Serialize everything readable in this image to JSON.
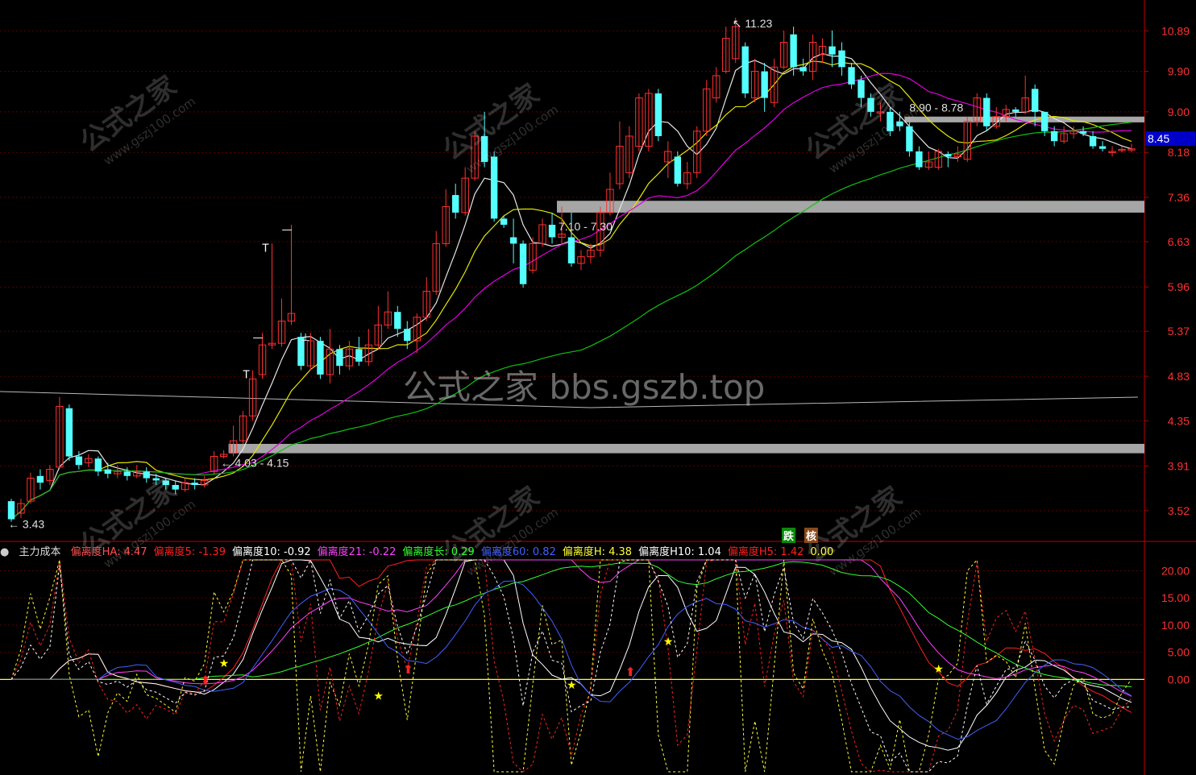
{
  "colors": {
    "background": "#000000",
    "bull": "#ff3030",
    "bear": "#54ffff",
    "axis": "#c00000",
    "ma_white": "#e6e6e6",
    "ma_yellow": "#e6e600",
    "ma_magenta": "#e000e0",
    "ma_green": "#10c010",
    "zone": "#a6a6a6",
    "price_tag_bg": "#0000c8"
  },
  "price_axis": {
    "labels": [
      "10.89",
      "9.90",
      "9.00",
      "8.18",
      "7.36",
      "6.63",
      "5.96",
      "5.37",
      "4.83",
      "4.35",
      "3.91",
      "3.52"
    ],
    "current_price": "8.45"
  },
  "annotations": {
    "high": "11.23",
    "low": "3.43",
    "zone_low": "4.03 - 4.15",
    "zone_mid": "7.10 - 7.30",
    "zone_high": "8.90 - 8.78"
  },
  "watermark": {
    "main": "公式之家 bbs.gszb.top",
    "stamp_cn": "公式之家",
    "stamp_url": "www.gszj100.com"
  },
  "signals": {
    "fall": "跌",
    "check": "核"
  },
  "indicator": {
    "name": "主力成本",
    "toggle_icon": "circle-toggle-icon",
    "items": [
      {
        "label": "偏离度HA: 4.47",
        "color": "#ff5050"
      },
      {
        "label": "偏离度5: -1.39",
        "color": "#ff2020"
      },
      {
        "label": "偏离度10: -0.92",
        "color": "#ffffff"
      },
      {
        "label": "偏离度21: -0.22",
        "color": "#ff40ff"
      },
      {
        "label": "偏离度长: 0.29",
        "color": "#30ff30"
      },
      {
        "label": "偏离度60: 0.82",
        "color": "#4060ff"
      },
      {
        "label": "偏离度H: 4.38",
        "color": "#ffff30"
      },
      {
        "label": "偏离度H10: 1.04",
        "color": "#ffffff"
      },
      {
        "label": "偏离度H5: 1.42",
        "color": "#ff2020"
      },
      {
        "label": "0.00",
        "color": "#ffff30"
      }
    ],
    "axis_labels": [
      "20.00",
      "15.00",
      "10.00",
      "5.00",
      "0.00"
    ]
  },
  "chart_data": {
    "type": "candlestick",
    "ylim": [
      3.3,
      11.6
    ],
    "candles": [
      [
        3.6,
        3.45,
        3.62,
        3.43
      ],
      [
        3.5,
        3.58,
        3.62,
        3.46
      ],
      [
        3.6,
        3.8,
        3.85,
        3.58
      ],
      [
        3.82,
        3.76,
        3.88,
        3.7
      ],
      [
        3.78,
        3.88,
        3.92,
        3.74
      ],
      [
        3.9,
        4.5,
        4.6,
        3.88
      ],
      [
        4.48,
        4.0,
        4.52,
        3.96
      ],
      [
        4.0,
        3.92,
        4.05,
        3.88
      ],
      [
        3.94,
        3.98,
        4.02,
        3.9
      ],
      [
        3.98,
        3.86,
        4.0,
        3.82
      ],
      [
        3.88,
        3.84,
        3.94,
        3.8
      ],
      [
        3.84,
        3.86,
        3.92,
        3.8
      ],
      [
        3.86,
        3.82,
        3.9,
        3.78
      ],
      [
        3.82,
        3.86,
        3.92,
        3.8
      ],
      [
        3.86,
        3.8,
        3.9,
        3.76
      ],
      [
        3.8,
        3.78,
        3.84,
        3.74
      ],
      [
        3.78,
        3.74,
        3.8,
        3.7
      ],
      [
        3.74,
        3.7,
        3.78,
        3.66
      ],
      [
        3.7,
        3.76,
        3.8,
        3.68
      ],
      [
        3.76,
        3.74,
        3.8,
        3.7
      ],
      [
        3.74,
        3.78,
        3.82,
        3.72
      ],
      [
        3.86,
        4.0,
        4.05,
        3.84
      ],
      [
        4.0,
        4.02,
        4.06,
        3.98
      ],
      [
        4.03,
        4.15,
        4.3,
        4.0
      ],
      [
        4.15,
        4.4,
        4.45,
        4.12
      ],
      [
        4.4,
        4.8,
        4.9,
        4.35
      ],
      [
        4.85,
        5.2,
        5.35,
        4.8
      ],
      [
        5.2,
        5.22,
        6.6,
        5.15
      ],
      [
        5.22,
        5.5,
        5.8,
        5.18
      ],
      [
        5.5,
        5.6,
        6.9,
        5.45
      ],
      [
        5.3,
        4.95,
        5.35,
        4.9
      ],
      [
        4.95,
        5.25,
        5.35,
        4.9
      ],
      [
        5.25,
        4.85,
        5.3,
        4.8
      ],
      [
        4.85,
        5.15,
        5.4,
        4.75
      ],
      [
        5.15,
        4.95,
        5.2,
        4.85
      ],
      [
        4.95,
        5.15,
        5.25,
        4.9
      ],
      [
        5.15,
        5.0,
        5.3,
        4.95
      ],
      [
        5.0,
        5.2,
        5.4,
        4.95
      ],
      [
        5.2,
        5.45,
        5.7,
        5.15
      ],
      [
        5.45,
        5.62,
        5.9,
        5.4
      ],
      [
        5.62,
        5.4,
        5.7,
        5.3
      ],
      [
        5.4,
        5.25,
        5.5,
        5.15
      ],
      [
        5.25,
        5.55,
        5.6,
        5.1
      ],
      [
        5.55,
        5.9,
        6.1,
        5.5
      ],
      [
        5.9,
        6.6,
        6.8,
        5.85
      ],
      [
        6.6,
        7.2,
        7.5,
        6.55
      ],
      [
        7.4,
        7.1,
        7.6,
        7.0
      ],
      [
        7.1,
        7.7,
        7.9,
        7.05
      ],
      [
        7.7,
        8.5,
        8.6,
        7.65
      ],
      [
        8.5,
        8.0,
        9.0,
        7.9
      ],
      [
        8.1,
        7.0,
        8.2,
        6.95
      ],
      [
        7.0,
        6.9,
        7.05,
        6.85
      ],
      [
        6.7,
        6.6,
        7.0,
        6.3
      ],
      [
        6.6,
        6.0,
        6.65,
        5.95
      ],
      [
        6.2,
        6.6,
        6.7,
        6.15
      ],
      [
        6.6,
        6.9,
        7.0,
        6.55
      ],
      [
        6.9,
        6.7,
        7.1,
        6.6
      ],
      [
        6.7,
        6.75,
        7.2,
        6.6
      ],
      [
        6.7,
        6.3,
        7.1,
        6.25
      ],
      [
        6.3,
        6.4,
        6.5,
        6.2
      ],
      [
        6.4,
        6.5,
        6.6,
        6.3
      ],
      [
        6.5,
        7.1,
        7.2,
        6.4
      ],
      [
        7.1,
        7.5,
        7.8,
        7.05
      ],
      [
        7.6,
        8.3,
        8.8,
        7.5
      ],
      [
        7.8,
        8.5,
        8.7,
        7.7
      ],
      [
        8.3,
        9.3,
        9.4,
        8.2
      ],
      [
        8.3,
        9.4,
        9.5,
        8.2
      ],
      [
        9.4,
        8.5,
        9.5,
        8.4
      ],
      [
        8.0,
        8.2,
        8.4,
        7.7
      ],
      [
        8.1,
        7.6,
        8.2,
        7.55
      ],
      [
        7.6,
        7.8,
        8.0,
        7.5
      ],
      [
        7.8,
        8.6,
        8.7,
        7.7
      ],
      [
        8.6,
        9.5,
        9.7,
        8.5
      ],
      [
        9.3,
        9.8,
        10.0,
        9.2
      ],
      [
        9.9,
        10.7,
        11.0,
        9.85
      ],
      [
        10.2,
        11.0,
        11.23,
        10.1
      ],
      [
        10.5,
        9.4,
        10.6,
        9.3
      ],
      [
        9.3,
        9.9,
        10.2,
        9.2
      ],
      [
        9.9,
        9.3,
        10.1,
        9.0
      ],
      [
        9.2,
        10.0,
        10.2,
        9.1
      ],
      [
        10.0,
        10.6,
        10.9,
        9.95
      ],
      [
        10.8,
        10.0,
        11.0,
        9.8
      ],
      [
        10.0,
        9.9,
        10.2,
        9.8
      ],
      [
        9.9,
        10.6,
        10.8,
        9.7
      ],
      [
        10.3,
        10.5,
        10.7,
        10.1
      ],
      [
        10.5,
        10.3,
        10.9,
        10.0
      ],
      [
        10.4,
        10.0,
        10.6,
        9.8
      ],
      [
        10.0,
        9.6,
        10.1,
        9.5
      ],
      [
        9.7,
        9.3,
        9.8,
        9.1
      ],
      [
        9.3,
        9.0,
        9.4,
        8.9
      ],
      [
        9.0,
        9.0,
        9.2,
        8.8
      ],
      [
        9.0,
        8.6,
        9.1,
        8.5
      ],
      [
        8.8,
        8.7,
        9.0,
        8.6
      ],
      [
        8.7,
        8.2,
        8.8,
        8.1
      ],
      [
        8.2,
        7.9,
        8.3,
        7.85
      ],
      [
        7.9,
        8.0,
        8.2,
        7.85
      ],
      [
        7.9,
        8.2,
        8.25,
        7.85
      ],
      [
        8.15,
        8.1,
        8.2,
        7.9
      ],
      [
        8.1,
        8.15,
        8.3,
        8.0
      ],
      [
        8.05,
        8.8,
        8.9,
        8.0
      ],
      [
        8.8,
        9.3,
        9.4,
        8.7
      ],
      [
        9.3,
        8.7,
        9.4,
        8.6
      ],
      [
        8.7,
        8.9,
        9.1,
        8.65
      ],
      [
        8.9,
        9.05,
        9.15,
        8.8
      ],
      [
        9.05,
        9.0,
        9.1,
        8.9
      ],
      [
        9.0,
        9.3,
        9.8,
        8.95
      ],
      [
        9.5,
        9.0,
        9.6,
        8.7
      ],
      [
        9.0,
        8.6,
        9.0,
        8.5
      ],
      [
        8.6,
        8.4,
        8.7,
        8.3
      ],
      [
        8.4,
        8.55,
        8.7,
        8.35
      ],
      [
        8.55,
        8.6,
        8.7,
        8.45
      ],
      [
        8.6,
        8.55,
        8.7,
        8.5
      ],
      [
        8.5,
        8.3,
        8.6,
        8.25
      ],
      [
        8.3,
        8.25,
        8.4,
        8.2
      ],
      [
        8.2,
        8.2,
        8.3,
        8.1
      ],
      [
        8.22,
        8.24,
        8.3,
        8.18
      ],
      [
        8.24,
        8.25,
        8.35,
        8.18
      ]
    ],
    "levels": [
      4.03,
      7.1,
      8.78
    ],
    "markers": [
      {
        "index": 27,
        "text": "T"
      },
      {
        "index": 26,
        "text": "—"
      },
      {
        "index": 29,
        "text": "—"
      },
      {
        "index": 31,
        "text": "⊥"
      },
      {
        "index": 25,
        "text": "T"
      }
    ],
    "lower_ylim": [
      -17,
      22
    ],
    "lower_ticks": [
      20,
      15,
      10,
      5,
      0
    ]
  }
}
